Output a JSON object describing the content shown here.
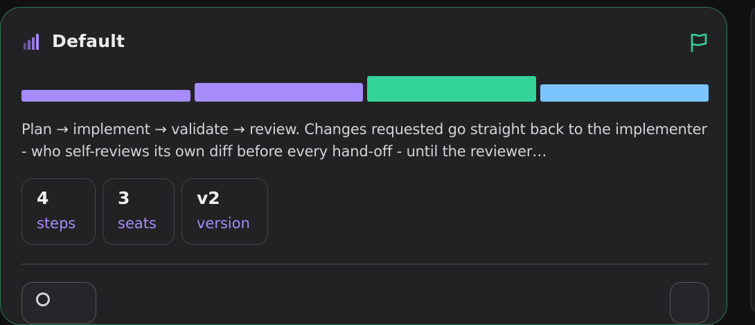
{
  "card": {
    "title": "Default",
    "description": "Plan → implement → validate → review. Changes requested go straight back to the implementer - who self-reviews its own diff before every hand-off - until the reviewer…",
    "stats": [
      {
        "value": "4",
        "label": "steps"
      },
      {
        "value": "3",
        "label": "seats"
      },
      {
        "value": "v2",
        "label": "version"
      }
    ],
    "pipeline_colors": [
      "#a78bfa",
      "#a78bfa",
      "#34d399",
      "#7cc4ff"
    ],
    "highlighted_step": 3
  },
  "icons": {
    "signal": "signal-bars-icon",
    "flag": "flag-icon"
  },
  "colors": {
    "accent": "#a78bfa",
    "success": "#34d399",
    "info": "#7cc4ff",
    "card_border": "#2a7a55"
  }
}
